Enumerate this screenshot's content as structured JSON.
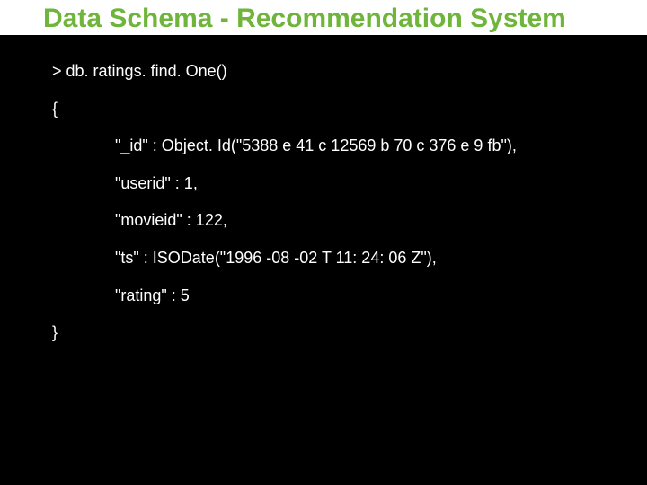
{
  "title": "Data Schema - Recommendation System",
  "console": {
    "command": "> db. ratings. find. One()",
    "open_brace": "{",
    "lines": [
      "\"_id\" : Object. Id(\"5388 e 41 c 12569 b 70 c 376 e 9 fb\"),",
      "\"userid\" : 1,",
      "\"movieid\" : 122,",
      "\"ts\" : ISODate(\"1996 -08 -02 T 11: 24: 06 Z\"),",
      "\"rating\" : 5"
    ],
    "close_brace": "}"
  }
}
